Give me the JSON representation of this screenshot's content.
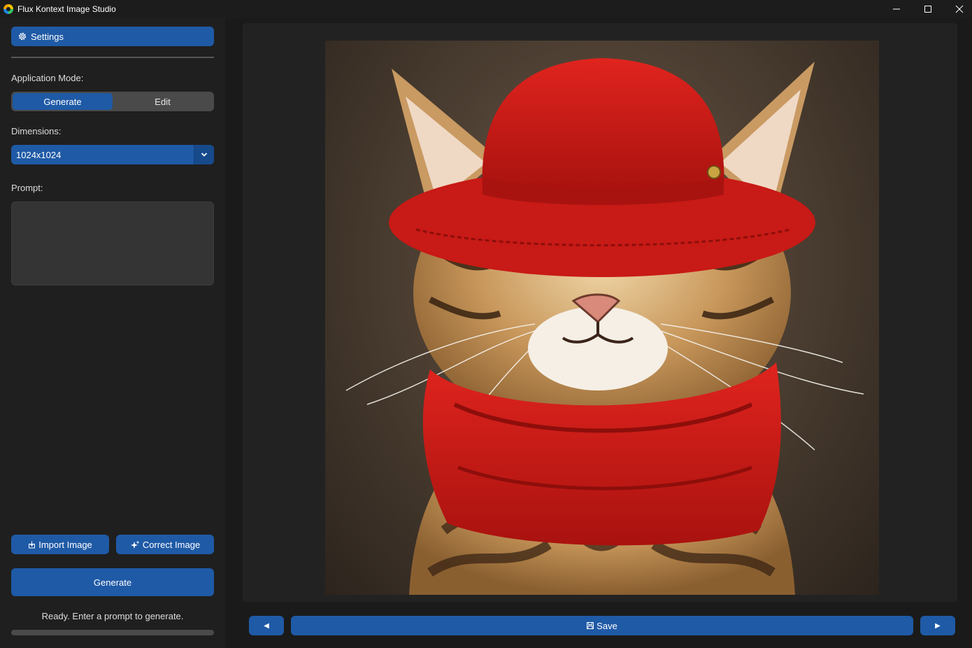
{
  "window": {
    "title": "Flux Kontext Image Studio",
    "icon": "app-logo-icon",
    "controls": [
      "minimize-icon",
      "maximize-icon",
      "close-icon"
    ]
  },
  "sidebar": {
    "settings_label": "Settings",
    "mode_label": "Application Mode:",
    "modes": [
      {
        "label": "Generate",
        "active": true
      },
      {
        "label": "Edit",
        "active": false
      }
    ],
    "dimensions_label": "Dimensions:",
    "dimensions_value": "1024x1024",
    "prompt_label": "Prompt:",
    "prompt_value": "",
    "import_label": "Import Image",
    "correct_label": "Correct Image",
    "generate_label": "Generate",
    "status_text": "Ready. Enter a prompt to generate.",
    "progress": 0
  },
  "viewer": {
    "image_subject": "tabby cat wearing red bucket hat and red scarf",
    "prev_label": "◀",
    "save_label": "Save",
    "next_label": "▶"
  },
  "colors": {
    "accent": "#1f5aa6",
    "sidebar_bg": "#1f1f1f",
    "main_bg": "#1a1a1a"
  }
}
